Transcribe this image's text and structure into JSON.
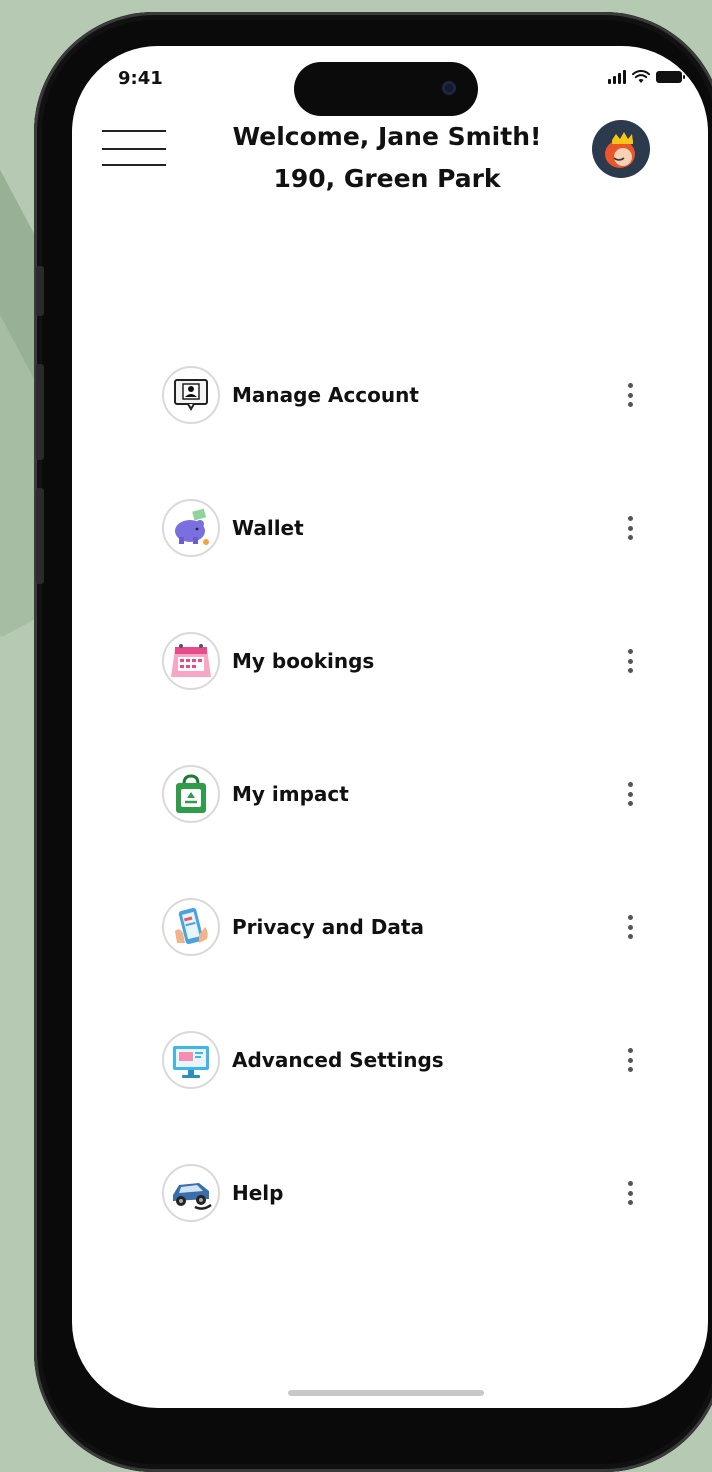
{
  "status_bar": {
    "time": "9:41"
  },
  "header": {
    "welcome_text": "Welcome, Jane Smith!",
    "address": "190, Green Park"
  },
  "menu": {
    "items": [
      {
        "label": "Manage Account",
        "icon": "manage-account-icon"
      },
      {
        "label": "Wallet",
        "icon": "piggy-bank-icon"
      },
      {
        "label": "My bookings",
        "icon": "calendar-icon"
      },
      {
        "label": "My impact",
        "icon": "recycle-bag-icon"
      },
      {
        "label": "Privacy and Data",
        "icon": "phone-hand-icon"
      },
      {
        "label": "Advanced Settings",
        "icon": "monitor-icon"
      },
      {
        "label": "Help",
        "icon": "help-car-icon"
      }
    ]
  },
  "colors": {
    "background": "#b5c9b3",
    "phone_frame": "#0a0a0a",
    "screen": "#ffffff",
    "text": "#111111"
  }
}
